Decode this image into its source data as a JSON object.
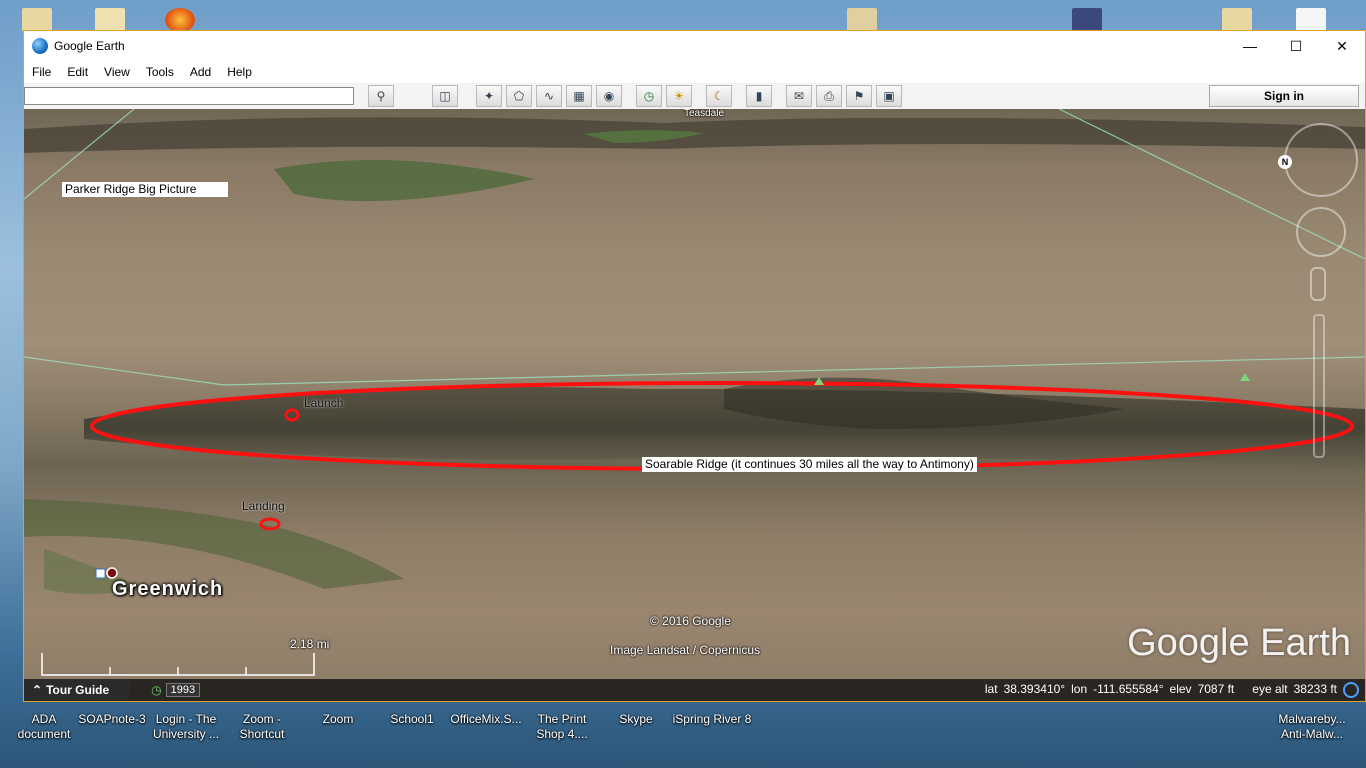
{
  "window": {
    "title": "Google Earth",
    "menu": [
      "File",
      "Edit",
      "View",
      "Tools",
      "Add",
      "Help"
    ],
    "search_placeholder": "",
    "sign_in": "Sign in"
  },
  "toolbar_icons": [
    "sidebar-toggle-icon",
    "placemark-icon",
    "polygon-icon",
    "path-icon",
    "image-overlay-icon",
    "record-tour-icon",
    "historical-imagery-icon",
    "sunlight-icon",
    "planets-icon",
    "ruler-icon",
    "email-icon",
    "print-icon",
    "view-in-maps-icon",
    "save-image-icon"
  ],
  "map": {
    "annotation_title": "Parker Ridge Big Picture",
    "launch": "Launch",
    "landing": "Landing",
    "ridge_label": "Soarable Ridge (it continues 30 miles all the way to Antimony)",
    "place": "Greenwich",
    "top_fragment": "Teasdale",
    "copyright": "© 2016 Google",
    "imagery": "Image Landsat / Copernicus",
    "scale": "2.18 mi",
    "brand": "Google Earth"
  },
  "status": {
    "tour_guide": "Tour Guide",
    "year": "1993",
    "lat_label": "lat",
    "lat": "38.393410°",
    "lon_label": "lon",
    "lon": "-111.655584°",
    "elev_label": "elev",
    "elev": "7087 ft",
    "eye_label": "eye alt",
    "eye": "38233 ft"
  },
  "desktop": {
    "icons": [
      {
        "label": "ADA document",
        "color": "#e8e8e8"
      },
      {
        "label": "SOAPnote-3",
        "color": "#2f5fb0"
      },
      {
        "label": "Login - The University ...",
        "color": "#d04020"
      },
      {
        "label": "Zoom - Shortcut",
        "color": "#2d8cff"
      },
      {
        "label": "Zoom",
        "color": "#2d8cff"
      },
      {
        "label": "School1",
        "color": "#e8c050"
      },
      {
        "label": "OfficeMix.S...",
        "color": "#d04a20"
      },
      {
        "label": "The Print Shop 4....",
        "color": "#c03030"
      },
      {
        "label": "Skype",
        "color": "#00aff0"
      },
      {
        "label": "iSpring River 8",
        "color": "#30a050"
      },
      {
        "label": "Malwareby... Anti-Malw...",
        "color": "#3060c0"
      }
    ]
  }
}
